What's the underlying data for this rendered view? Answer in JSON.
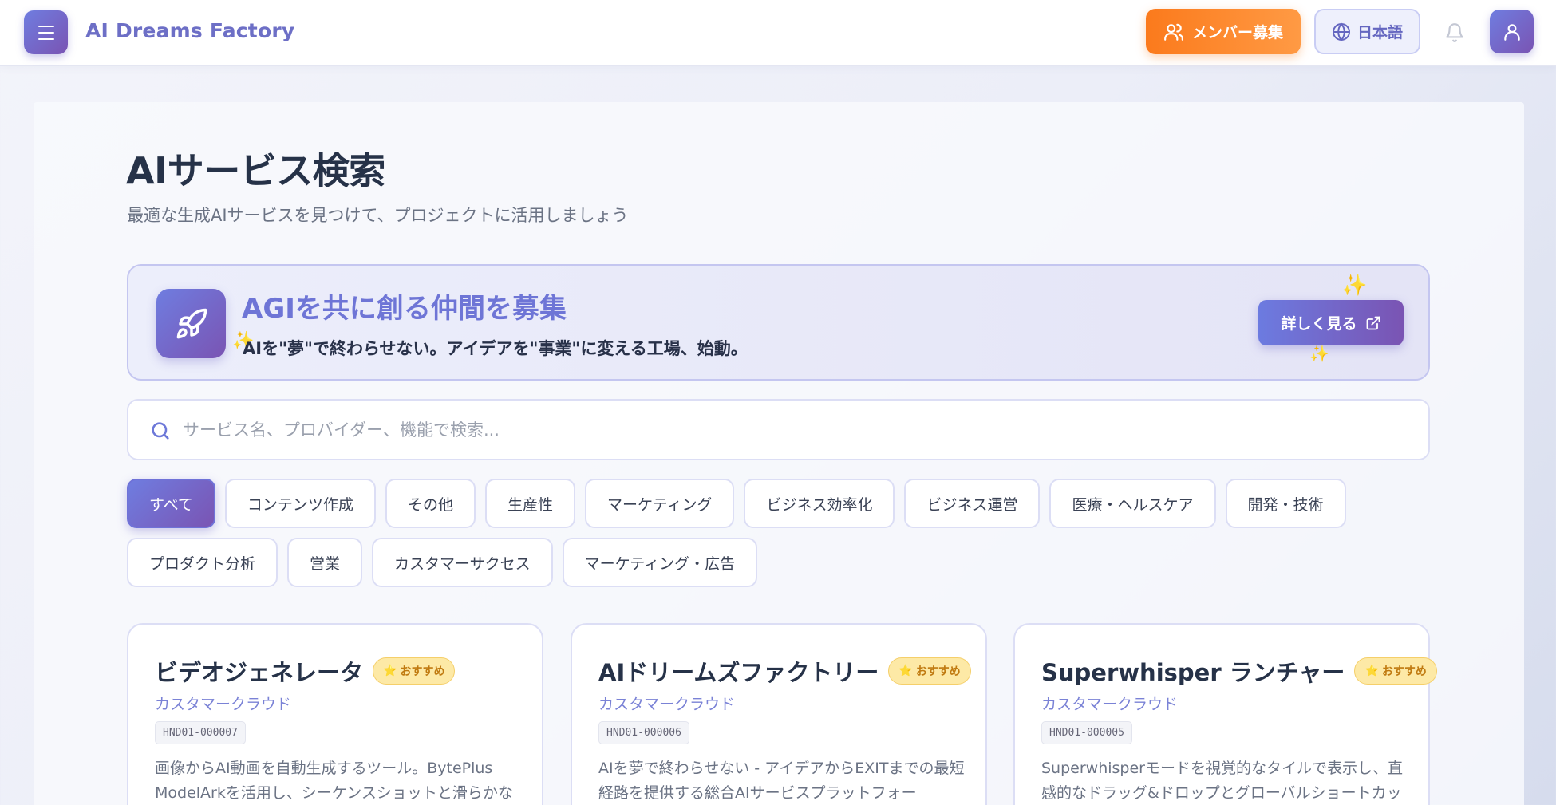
{
  "header": {
    "brand": "AI Dreams Factory",
    "recruit_label": "メンバー募集",
    "lang_label": "日本語",
    "icons": {
      "menu": "menu-icon",
      "users": "users-icon",
      "globe": "globe-icon",
      "bell": "bell-icon",
      "user": "user-icon"
    }
  },
  "page": {
    "title": "AIサービス検索",
    "subtitle": "最適な生成AIサービスを見つけて、プロジェクトに活用しましょう"
  },
  "banner": {
    "title": "AGIを共に創る仲間を募集",
    "subtitle": "AIを\"夢\"で終わらせない。アイデアを\"事業\"に変える工場、始動。",
    "button_label": "詳しく見る"
  },
  "search": {
    "placeholder": "サービス名、プロバイダー、機能で検索...",
    "value": ""
  },
  "categories": [
    "すべて",
    "コンテンツ作成",
    "その他",
    "生産性",
    "マーケティング",
    "ビジネス効率化",
    "ビジネス運営",
    "医療・ヘルスケア",
    "開発・技術",
    "プロダクト分析",
    "営業",
    "カスタマーサクセス",
    "マーケティング・広告"
  ],
  "active_category": "すべて",
  "cards": [
    {
      "title": "ビデオジェネレータ",
      "badge": "おすすめ",
      "provider": "カスタマークラウド",
      "code": "HND01-000007",
      "description": "画像からAI動画を自動生成するツール。BytePlus ModelArkを活用し、シーケンスショットと滑らかな"
    },
    {
      "title": "AIドリームズファクトリー",
      "badge": "おすすめ",
      "provider": "カスタマークラウド",
      "code": "HND01-000006",
      "description": "AIを夢で終わらせない - アイデアからEXITまでの最短経路を提供する総合AIサービスプラットフォー"
    },
    {
      "title": "Superwhisper ランチャー",
      "badge": "おすすめ",
      "provider": "カスタマークラウド",
      "code": "HND01-000005",
      "description": "Superwhisperモードを視覚的なタイルで表示し、直感的なドラッグ&ドロップとグローバルショートカッ"
    }
  ],
  "colors": {
    "accent": "#6f7de0",
    "accent_dark": "#7a54b3",
    "orange": "#fb7a1c",
    "badge_bg": "#fde9a6"
  }
}
